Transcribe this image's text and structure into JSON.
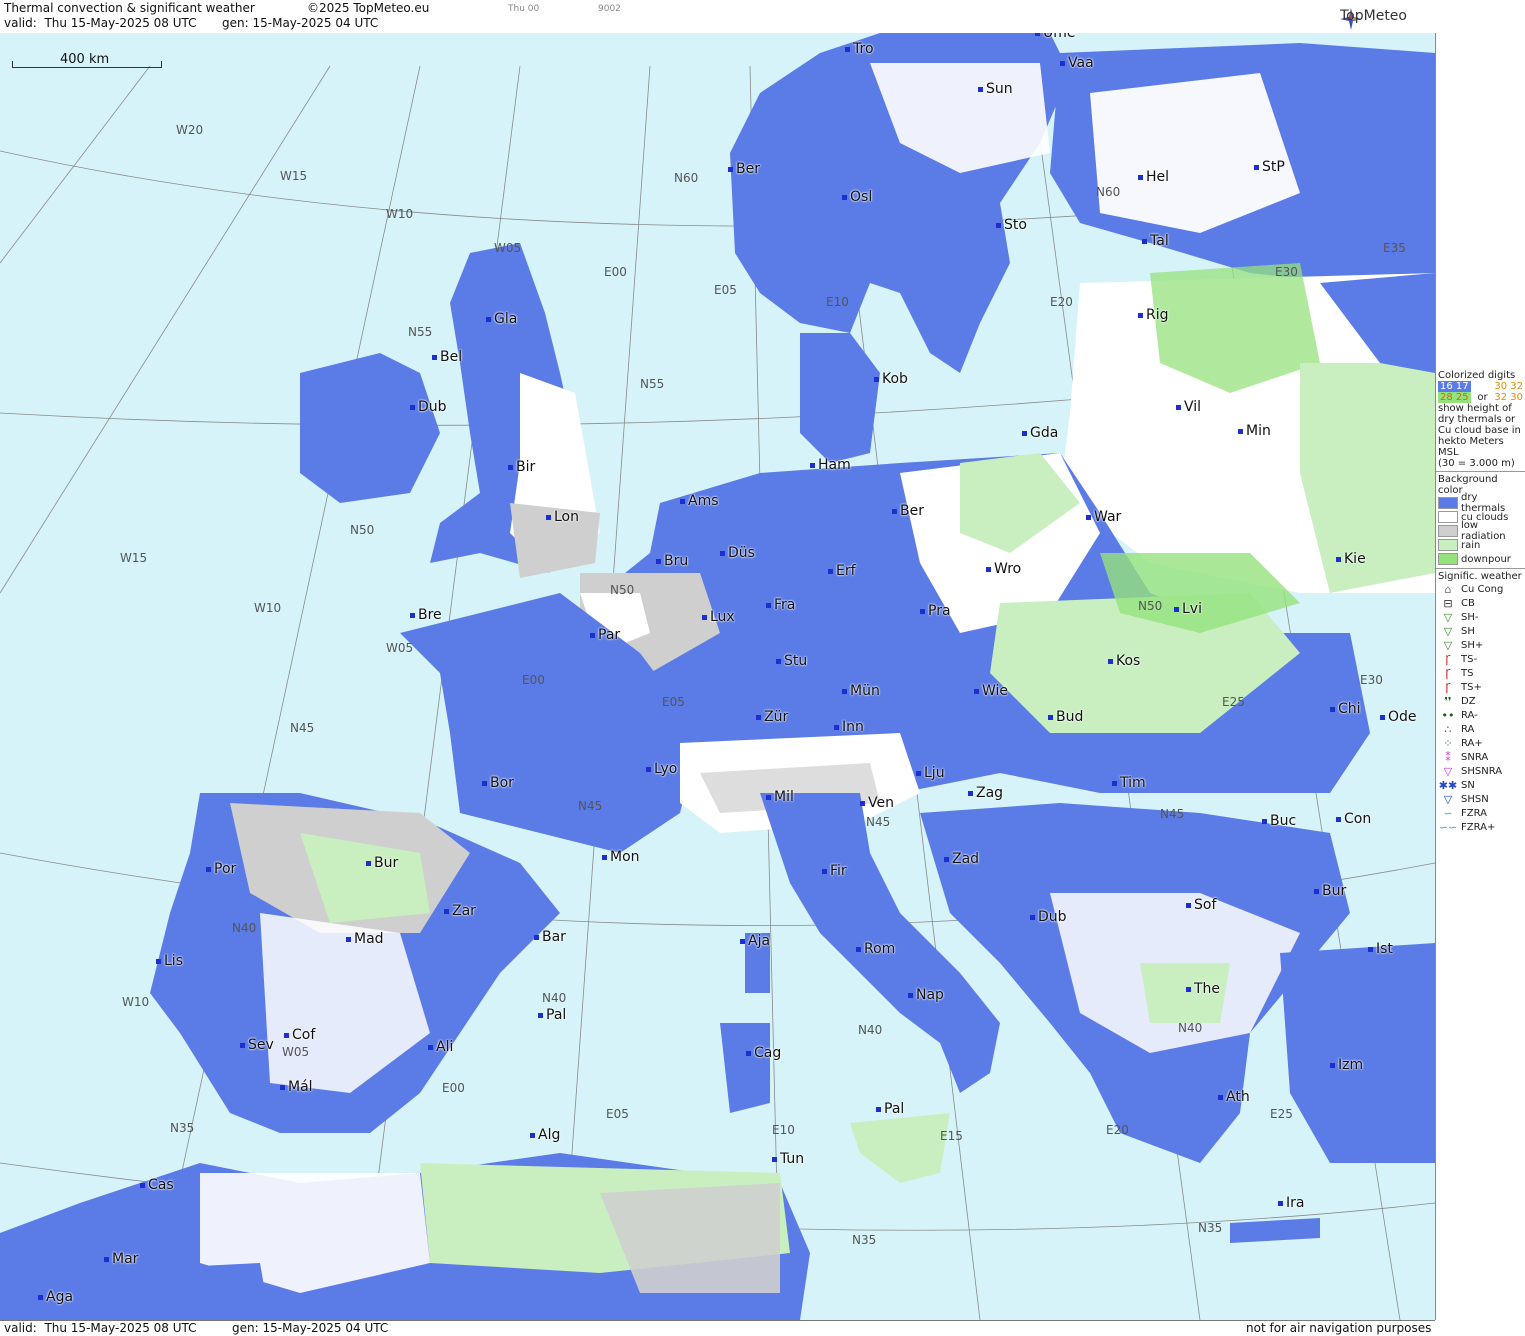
{
  "header": {
    "title": "Thermal convection & significant weather",
    "copyright": "©2025 TopMeteo.eu",
    "day_tag": "Thu 00",
    "code": "9002",
    "valid_label": "valid:",
    "valid_value": "Thu 15-May-2025 08 UTC",
    "gen_label": "gen:",
    "gen_value": "15-May-2025 04 UTC",
    "brand": "TopMeteo"
  },
  "footer": {
    "valid_label": "valid:",
    "valid_value": "Thu 15-May-2025 08 UTC",
    "gen_label": "gen:",
    "gen_value": "15-May-2025 04 UTC",
    "disclaimer": "not for air navigation purposes"
  },
  "scale_bar": {
    "label": "400 km"
  },
  "colors": {
    "sea": "#d6f3f9",
    "dry_thermals": "#5b7be6",
    "cu_clouds": "#ffffff",
    "low_radiation": "#cfcfcf",
    "rain": "#c9efc0",
    "downpour": "#95e27d",
    "city_dot": "#1d2fcf"
  },
  "cities": [
    {
      "name": "Tro"
    },
    {
      "name": "Ume"
    },
    {
      "name": "Vaa"
    },
    {
      "name": "Sun"
    },
    {
      "name": "Ber"
    },
    {
      "name": "Osl"
    },
    {
      "name": "Hel"
    },
    {
      "name": "StP"
    },
    {
      "name": "Sto"
    },
    {
      "name": "Tal"
    },
    {
      "name": "Gla"
    },
    {
      "name": "Bel"
    },
    {
      "name": "Dub"
    },
    {
      "name": "Rig"
    },
    {
      "name": "Kob"
    },
    {
      "name": "Vil"
    },
    {
      "name": "Min"
    },
    {
      "name": "Gda"
    },
    {
      "name": "Bir"
    },
    {
      "name": "Ham"
    },
    {
      "name": "Ams"
    },
    {
      "name": "Lon"
    },
    {
      "name": "Ber"
    },
    {
      "name": "War"
    },
    {
      "name": "Bru"
    },
    {
      "name": "Düs"
    },
    {
      "name": "Erf"
    },
    {
      "name": "Wro"
    },
    {
      "name": "Kie"
    },
    {
      "name": "Bre"
    },
    {
      "name": "Lux"
    },
    {
      "name": "Fra"
    },
    {
      "name": "Pra"
    },
    {
      "name": "Par"
    },
    {
      "name": "Lvi"
    },
    {
      "name": "Stu"
    },
    {
      "name": "Kos"
    },
    {
      "name": "Mün"
    },
    {
      "name": "Wie"
    },
    {
      "name": "Zür"
    },
    {
      "name": "Inn"
    },
    {
      "name": "Bud"
    },
    {
      "name": "Chi"
    },
    {
      "name": "Ode"
    },
    {
      "name": "Lyo"
    },
    {
      "name": "Lju"
    },
    {
      "name": "Bor"
    },
    {
      "name": "Mil"
    },
    {
      "name": "Zag"
    },
    {
      "name": "Tim"
    },
    {
      "name": "Ven"
    },
    {
      "name": "Buc"
    },
    {
      "name": "Con"
    },
    {
      "name": "Mon"
    },
    {
      "name": "Fir"
    },
    {
      "name": "Zad"
    },
    {
      "name": "Bur"
    },
    {
      "name": "Por"
    },
    {
      "name": "Zar"
    },
    {
      "name": "Sof"
    },
    {
      "name": "Bur"
    },
    {
      "name": "Mad"
    },
    {
      "name": "Bar"
    },
    {
      "name": "Aja"
    },
    {
      "name": "Rom"
    },
    {
      "name": "Dub"
    },
    {
      "name": "Ist"
    },
    {
      "name": "Lis"
    },
    {
      "name": "The"
    },
    {
      "name": "Nap"
    },
    {
      "name": "Pal"
    },
    {
      "name": "Cof"
    },
    {
      "name": "Sev"
    },
    {
      "name": "Ali"
    },
    {
      "name": "Cag"
    },
    {
      "name": "Mál"
    },
    {
      "name": "Izm"
    },
    {
      "name": "Ath"
    },
    {
      "name": "Pal"
    },
    {
      "name": "Alg"
    },
    {
      "name": "Tun"
    },
    {
      "name": "Cas"
    },
    {
      "name": "Ira"
    },
    {
      "name": "Mar"
    },
    {
      "name": "Aga"
    }
  ],
  "grid_labels": [
    "W20",
    "W15",
    "W10",
    "W05",
    "E00",
    "E05",
    "E10",
    "E20",
    "E30",
    "E35",
    "N60",
    "N60",
    "N55",
    "N55",
    "N50",
    "N50",
    "N50",
    "W15",
    "W10",
    "W05",
    "N45",
    "E00",
    "E05",
    "N45",
    "N45",
    "N45",
    "E30",
    "E25",
    "N40",
    "N40",
    "N40",
    "N40",
    "W10",
    "W05",
    "E00",
    "E05",
    "E10",
    "E15",
    "E20",
    "E25",
    "N35",
    "N35",
    "N35"
  ],
  "legend": {
    "colorized_title": "Colorized digits",
    "samples": [
      "16 17",
      "30 32",
      "28 25",
      "32 30"
    ],
    "or": "or",
    "desc": "show height of dry thermals or Cu cloud base in hekto Meters MSL",
    "example": "(30 = 3.000 m)",
    "bg_title": "Background color",
    "bg_items": [
      {
        "label": "dry thermals",
        "color": "#5b7be6"
      },
      {
        "label": "cu clouds",
        "color": "#ffffff"
      },
      {
        "label": "low radiation",
        "color": "#cfcfcf"
      },
      {
        "label": "rain",
        "color": "#c9efc0"
      },
      {
        "label": "downpour",
        "color": "#95e27d"
      }
    ],
    "wx_title": "Signific. weather",
    "wx_items": [
      {
        "label": "Cu Cong",
        "sym": "⌂",
        "color": "#777777"
      },
      {
        "label": "CB",
        "sym": "⊟",
        "color": "#333333"
      },
      {
        "label": "SH-",
        "sym": "▽",
        "color": "#2e8b2e"
      },
      {
        "label": "SH",
        "sym": "▽",
        "color": "#2e8b2e"
      },
      {
        "label": "SH+",
        "sym": "▽",
        "color": "#2e8b2e"
      },
      {
        "label": "TS-",
        "sym": "Ꞅ",
        "color": "#cc1111"
      },
      {
        "label": "TS",
        "sym": "Ꞅ",
        "color": "#cc1111"
      },
      {
        "label": "TS+",
        "sym": "Ꞅ",
        "color": "#cc1111"
      },
      {
        "label": "DZ",
        "sym": "❜❜",
        "color": "#1a5a1a"
      },
      {
        "label": "RA-",
        "sym": "••",
        "color": "#1a5a1a"
      },
      {
        "label": "RA",
        "sym": "∴",
        "color": "#1a5a1a"
      },
      {
        "label": "RA+",
        "sym": "⁘",
        "color": "#1a5a1a"
      },
      {
        "label": "SNRA",
        "sym": "⁑",
        "color": "#cc33cc"
      },
      {
        "label": "SHSNRA",
        "sym": "▽",
        "color": "#cc33cc"
      },
      {
        "label": "SN",
        "sym": "✱✱",
        "color": "#2244cc"
      },
      {
        "label": "SHSN",
        "sym": "▽",
        "color": "#2244cc"
      },
      {
        "label": "FZRA",
        "sym": "∽",
        "color": "#22bbcc"
      },
      {
        "label": "FZRA+",
        "sym": "∽∽",
        "color": "#22bbcc"
      }
    ]
  }
}
